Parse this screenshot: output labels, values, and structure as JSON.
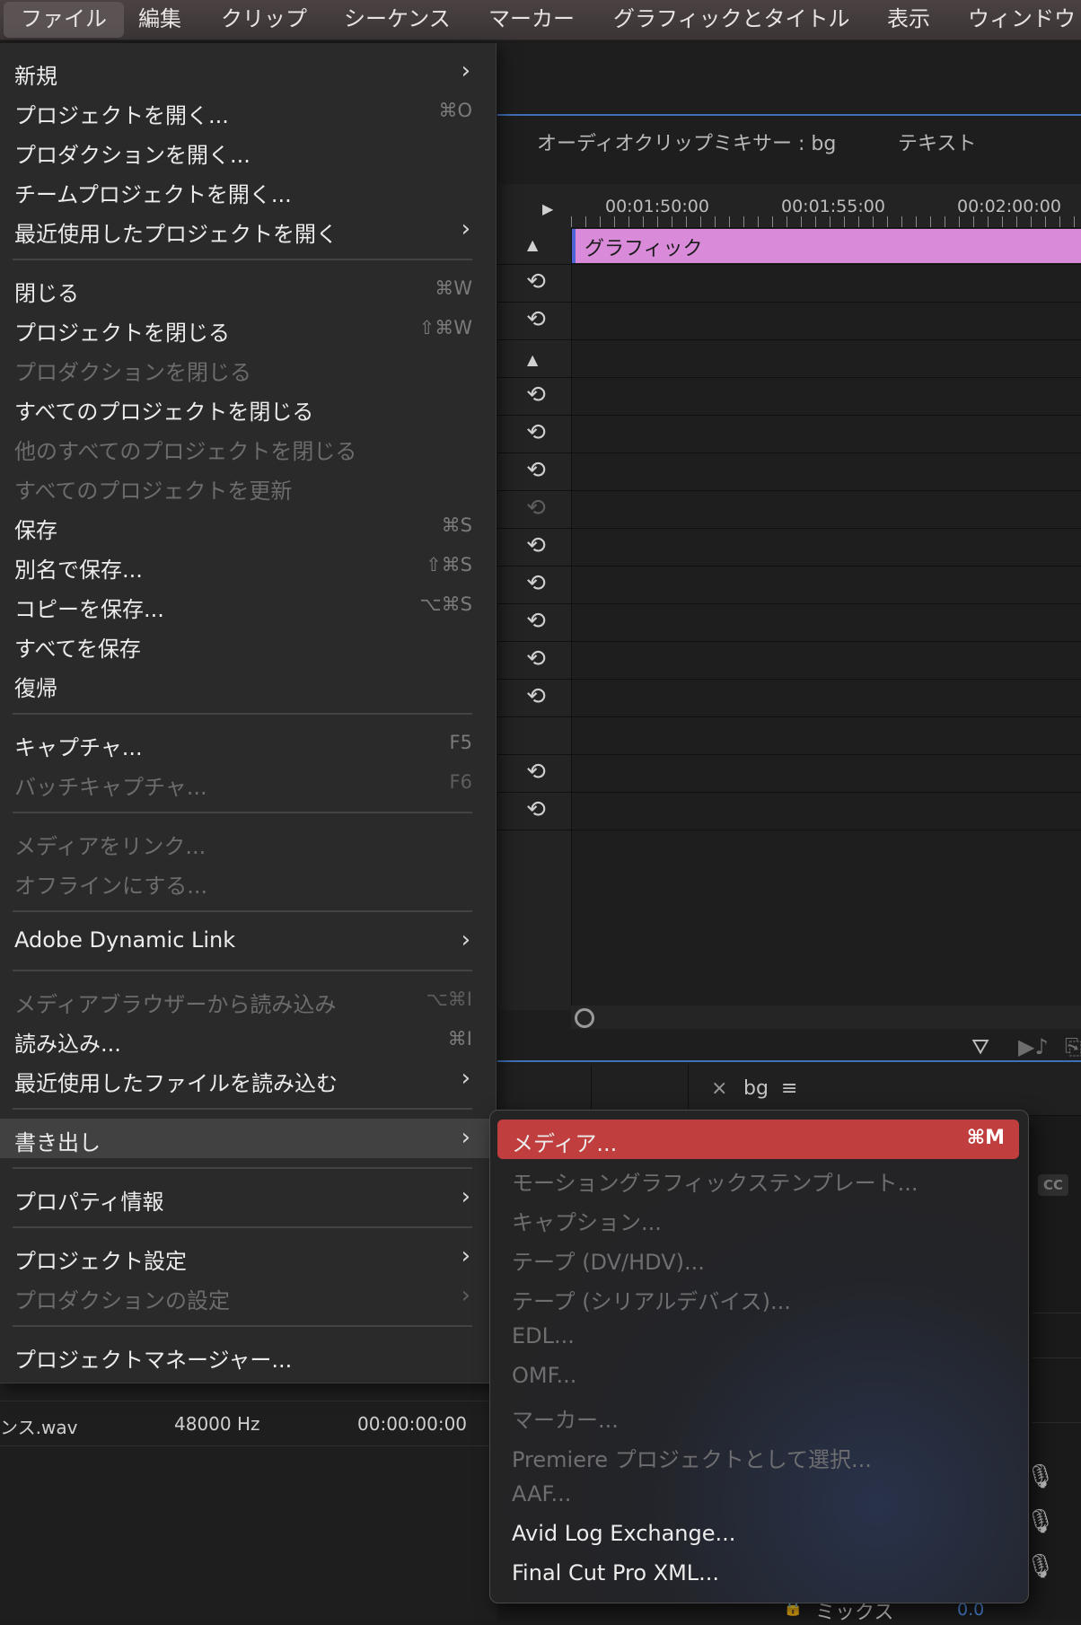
{
  "menubar": {
    "items": [
      "ファイル",
      "編集",
      "クリップ",
      "シーケンス",
      "マーカー",
      "グラフィックとタイトル",
      "表示",
      "ウィンドウ"
    ]
  },
  "timeline": {
    "tab_mixer": "オーディオクリップミキサー : bg",
    "tab_text": "テキスト",
    "timecodes": [
      "00:01:50:00",
      "00:01:55:00",
      "00:02:00:00"
    ],
    "clip_label": "グラフィック",
    "lower_tab_close": "×",
    "lower_tab_name": "bg",
    "lower_tab_menu": "≡",
    "cc_label": "CC",
    "mix_label": "ミックス",
    "mix_value": "0.0"
  },
  "left_remains": {
    "filename": "ンス.wav",
    "rate": "48000 Hz",
    "timecode": "00:00:00:00"
  },
  "file_menu": {
    "items": [
      {
        "label": "新規",
        "shortcut": "",
        "submenu": true,
        "disabled": false
      },
      {
        "label": "プロジェクトを開く...",
        "shortcut": "⌘O",
        "submenu": false,
        "disabled": false
      },
      {
        "label": "プロダクションを開く...",
        "shortcut": "",
        "submenu": false,
        "disabled": false
      },
      {
        "label": "チームプロジェクトを開く...",
        "shortcut": "",
        "submenu": false,
        "disabled": false
      },
      {
        "label": "最近使用したプロジェクトを開く",
        "shortcut": "",
        "submenu": true,
        "disabled": false
      },
      {
        "label": "閉じる",
        "shortcut": "⌘W",
        "submenu": false,
        "disabled": false
      },
      {
        "label": "プロジェクトを閉じる",
        "shortcut": "⇧⌘W",
        "submenu": false,
        "disabled": false
      },
      {
        "label": "プロダクションを閉じる",
        "shortcut": "",
        "submenu": false,
        "disabled": true
      },
      {
        "label": "すべてのプロジェクトを閉じる",
        "shortcut": "",
        "submenu": false,
        "disabled": false
      },
      {
        "label": "他のすべてのプロジェクトを閉じる",
        "shortcut": "",
        "submenu": false,
        "disabled": true
      },
      {
        "label": "すべてのプロジェクトを更新",
        "shortcut": "",
        "submenu": false,
        "disabled": true
      },
      {
        "label": "保存",
        "shortcut": "⌘S",
        "submenu": false,
        "disabled": false
      },
      {
        "label": "別名で保存...",
        "shortcut": "⇧⌘S",
        "submenu": false,
        "disabled": false
      },
      {
        "label": "コピーを保存...",
        "shortcut": "⌥⌘S",
        "submenu": false,
        "disabled": false
      },
      {
        "label": "すべてを保存",
        "shortcut": "",
        "submenu": false,
        "disabled": false
      },
      {
        "label": "復帰",
        "shortcut": "",
        "submenu": false,
        "disabled": false
      },
      {
        "label": "キャプチャ...",
        "shortcut": "F5",
        "submenu": false,
        "disabled": false
      },
      {
        "label": "バッチキャプチャ...",
        "shortcut": "F6",
        "submenu": false,
        "disabled": true
      },
      {
        "label": "メディアをリンク...",
        "shortcut": "",
        "submenu": false,
        "disabled": true
      },
      {
        "label": "オフラインにする...",
        "shortcut": "",
        "submenu": false,
        "disabled": true
      },
      {
        "label": "Adobe Dynamic Link",
        "shortcut": "",
        "submenu": true,
        "disabled": false
      },
      {
        "label": "メディアブラウザーから読み込み",
        "shortcut": "⌥⌘I",
        "submenu": false,
        "disabled": true
      },
      {
        "label": "読み込み...",
        "shortcut": "⌘I",
        "submenu": false,
        "disabled": false
      },
      {
        "label": "最近使用したファイルを読み込む",
        "shortcut": "",
        "submenu": true,
        "disabled": false
      },
      {
        "label": "書き出し",
        "shortcut": "",
        "submenu": true,
        "disabled": false,
        "highlighted": true
      },
      {
        "label": "プロパティ情報",
        "shortcut": "",
        "submenu": true,
        "disabled": false
      },
      {
        "label": "プロジェクト設定",
        "shortcut": "",
        "submenu": true,
        "disabled": false
      },
      {
        "label": "プロダクションの設定",
        "shortcut": "",
        "submenu": true,
        "disabled": true
      },
      {
        "label": "プロジェクトマネージャー...",
        "shortcut": "",
        "submenu": false,
        "disabled": false
      }
    ]
  },
  "export_menu": {
    "items": [
      {
        "label": "メディア...",
        "shortcut": "⌘M",
        "selected": true,
        "disabled": false
      },
      {
        "label": "モーショングラフィックステンプレート...",
        "shortcut": "",
        "disabled": true
      },
      {
        "label": "キャプション...",
        "shortcut": "",
        "disabled": true
      },
      {
        "label": "テープ (DV/HDV)...",
        "shortcut": "",
        "disabled": true
      },
      {
        "label": "テープ (シリアルデバイス)...",
        "shortcut": "",
        "disabled": true
      },
      {
        "label": "EDL...",
        "shortcut": "",
        "disabled": true
      },
      {
        "label": "OMF...",
        "shortcut": "",
        "disabled": true
      },
      {
        "label": "マーカー...",
        "shortcut": "",
        "disabled": true
      },
      {
        "label": "Premiere プロジェクトとして選択...",
        "shortcut": "",
        "disabled": true
      },
      {
        "label": "AAF...",
        "shortcut": "",
        "disabled": true
      },
      {
        "label": "Avid Log Exchange...",
        "shortcut": "",
        "disabled": false
      },
      {
        "label": "Final Cut Pro XML...",
        "shortcut": "",
        "disabled": false
      }
    ]
  },
  "colors": {
    "menu_bg": "#2a2a2b",
    "highlight": "#414142",
    "selected_red": "#c03e3e",
    "clip_pink": "#d98ad9",
    "panel_blue": "#3f6fb5"
  }
}
